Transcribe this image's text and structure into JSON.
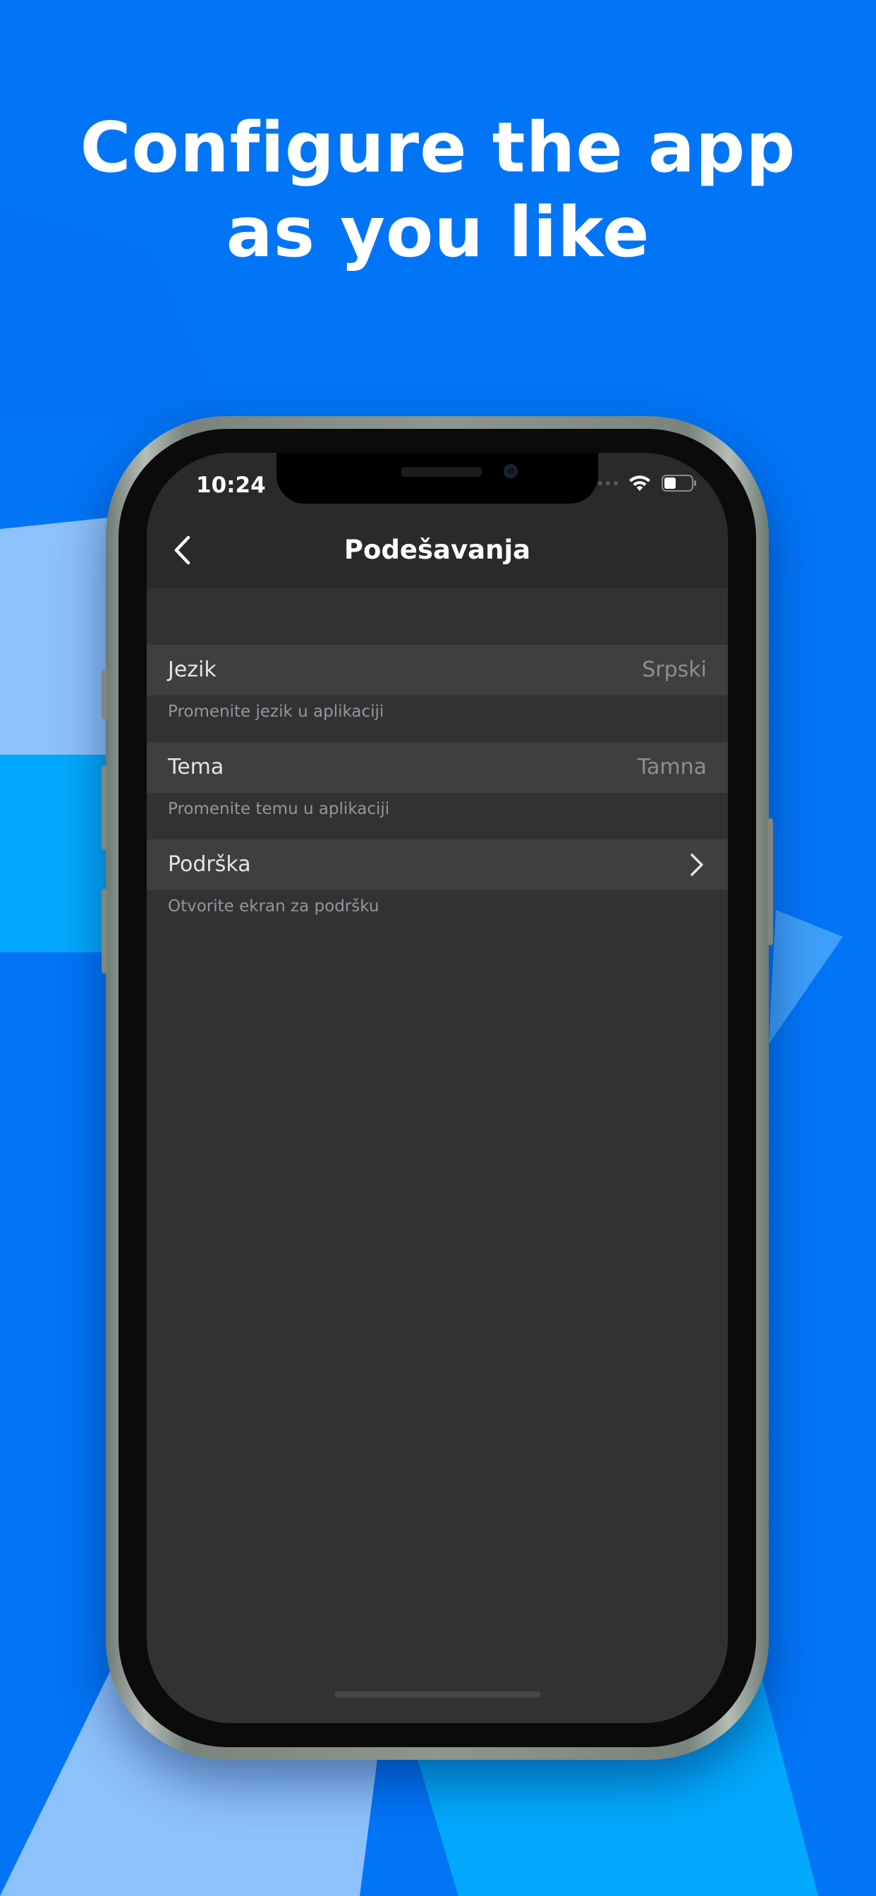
{
  "headline": {
    "line1": "Configure the app",
    "line2": "as you like"
  },
  "colors": {
    "background": "#0275f7",
    "screen": "#313234",
    "row": "#3e3f41",
    "accent_light": "#8dc1fb",
    "accent_cyan": "#03a9fd"
  },
  "status_bar": {
    "time": "10:24",
    "icons": [
      "signal-dots-icon",
      "wifi-icon",
      "battery-icon"
    ]
  },
  "nav": {
    "back_icon": "chevron-left-icon",
    "title": "Podešavanja"
  },
  "settings": {
    "language": {
      "label": "Jezik",
      "value": "Srpski",
      "description": "Promenite jezik u aplikaciji"
    },
    "theme": {
      "label": "Tema",
      "value": "Tamna",
      "description": "Promenite temu u aplikaciji"
    },
    "support": {
      "label": "Podrška",
      "icon": "chevron-right-icon",
      "description": "Otvorite ekran za podršku"
    }
  }
}
